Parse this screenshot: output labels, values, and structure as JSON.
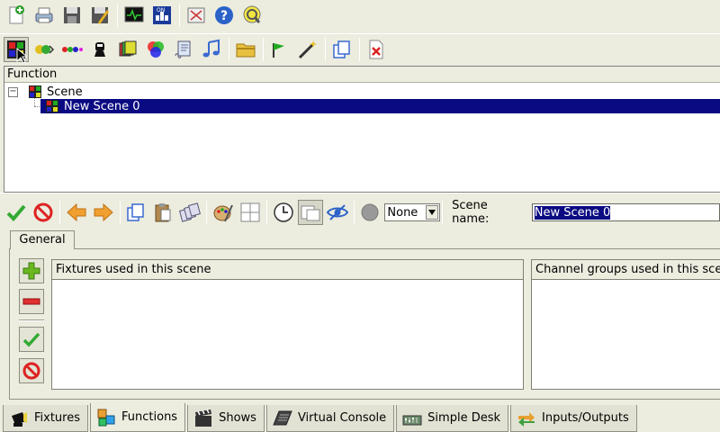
{
  "toolbar_main": {
    "icons": [
      "new-workspace-icon",
      "open-workspace-icon",
      "save-workspace-icon",
      "save-as-icon",
      "monitor-icon",
      "dmx-dump-icon",
      "fullscreen-icon",
      "help-icon",
      "blackout-icon"
    ]
  },
  "toolbar_functions": {
    "icons": [
      "new-scene-icon",
      "new-chaser-icon",
      "new-sequence-icon",
      "new-efx-icon",
      "new-collection-icon",
      "new-rgb-matrix-icon",
      "new-script-icon",
      "new-audio-icon",
      "new-folder-icon",
      "wizard-icon",
      "clone-icon",
      "delete-icon"
    ],
    "active": "new-scene-icon"
  },
  "function_tree": {
    "header": "Function",
    "items": [
      {
        "label": "Scene",
        "expanded": true
      },
      {
        "label": "New Scene 0",
        "selected": true
      }
    ]
  },
  "scene_editor": {
    "speed_combo_value": "None",
    "scene_name_label": "Scene name:",
    "scene_name_value": "New Scene 0",
    "tab_label": "General",
    "fixtures_header": "Fixtures used in this scene",
    "channel_groups_header": "Channel groups used in this scene"
  },
  "bottom_tabs": [
    {
      "label": "Fixtures",
      "icon": "fixtures-icon"
    },
    {
      "label": "Functions",
      "icon": "functions-icon",
      "selected": true
    },
    {
      "label": "Shows",
      "icon": "shows-icon"
    },
    {
      "label": "Virtual Console",
      "icon": "virtual-console-icon"
    },
    {
      "label": "Simple Desk",
      "icon": "simple-desk-icon"
    },
    {
      "label": "Inputs/Outputs",
      "icon": "inputs-outputs-icon"
    }
  ],
  "colors": {
    "background": "#ececdf",
    "selection": "#0a0a82"
  }
}
